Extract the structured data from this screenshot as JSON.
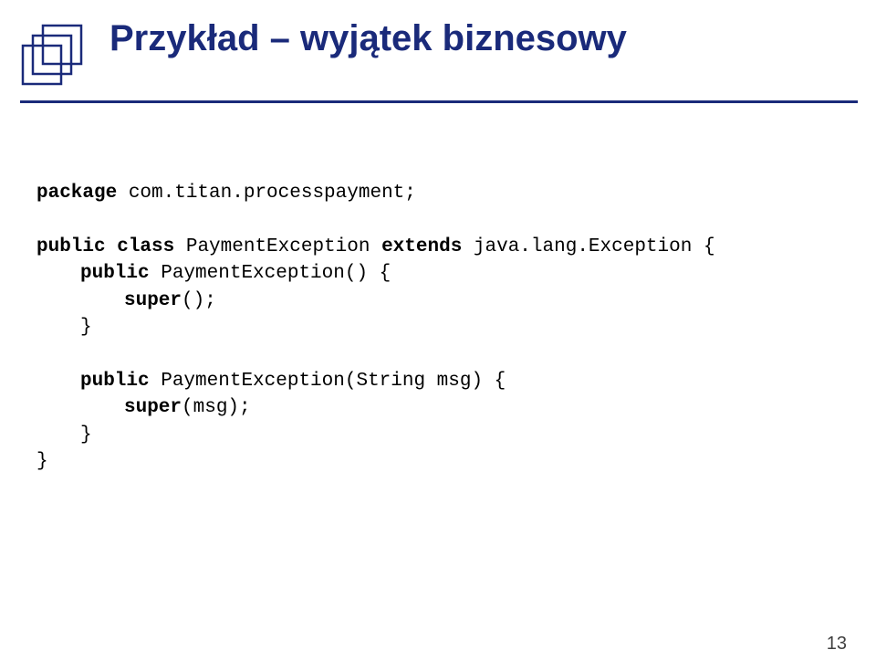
{
  "title": "Przykład – wyjątek biznesowy",
  "code": {
    "line1_kw": "package",
    "line1_rest": " com.titan.processpayment;",
    "line2_pre": "public class",
    "line2_mid": " PaymentException ",
    "line2_kw2": "extends",
    "line2_rest": " java.lang.Exception {",
    "line3_pre": "public",
    "line3_rest": " PaymentException() {",
    "line4_pre": "super",
    "line4_rest": "();",
    "line5": "}",
    "line6_pre": "public",
    "line6_rest": " PaymentException(String msg) {",
    "line7_pre": "super",
    "line7_rest": "(msg);",
    "line8": "}",
    "line9": "}"
  },
  "pagenum": "13"
}
